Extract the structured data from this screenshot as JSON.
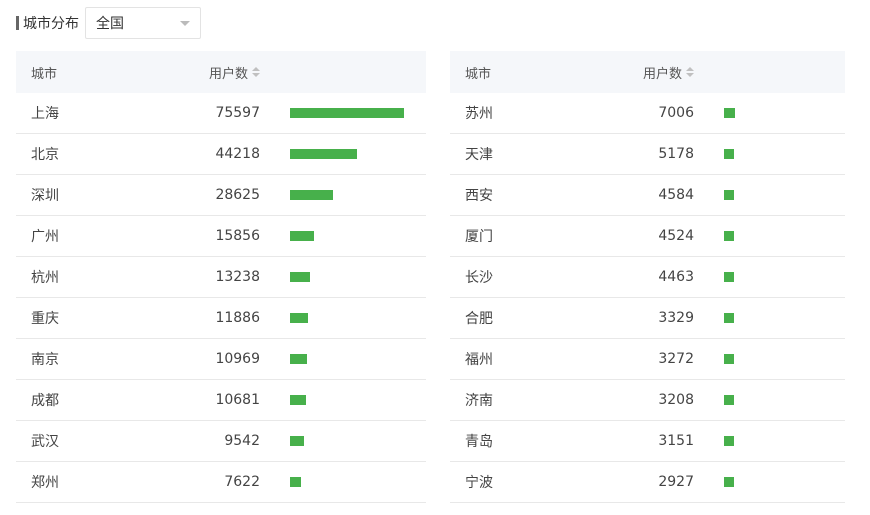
{
  "header": {
    "title": "城市分布",
    "select_value": "全国"
  },
  "table": {
    "col_city": "城市",
    "col_users": "用户数"
  },
  "colors": {
    "bar": "#47b04b"
  },
  "max_users": 75597,
  "left_rows": [
    {
      "city": "上海",
      "users": 75597
    },
    {
      "city": "北京",
      "users": 44218
    },
    {
      "city": "深圳",
      "users": 28625
    },
    {
      "city": "广州",
      "users": 15856
    },
    {
      "city": "杭州",
      "users": 13238
    },
    {
      "city": "重庆",
      "users": 11886
    },
    {
      "city": "南京",
      "users": 10969
    },
    {
      "city": "成都",
      "users": 10681
    },
    {
      "city": "武汉",
      "users": 9542
    },
    {
      "city": "郑州",
      "users": 7622
    }
  ],
  "right_rows": [
    {
      "city": "苏州",
      "users": 7006
    },
    {
      "city": "天津",
      "users": 5178
    },
    {
      "city": "西安",
      "users": 4584
    },
    {
      "city": "厦门",
      "users": 4524
    },
    {
      "city": "长沙",
      "users": 4463
    },
    {
      "city": "合肥",
      "users": 3329
    },
    {
      "city": "福州",
      "users": 3272
    },
    {
      "city": "济南",
      "users": 3208
    },
    {
      "city": "青岛",
      "users": 3151
    },
    {
      "city": "宁波",
      "users": 2927
    }
  ]
}
